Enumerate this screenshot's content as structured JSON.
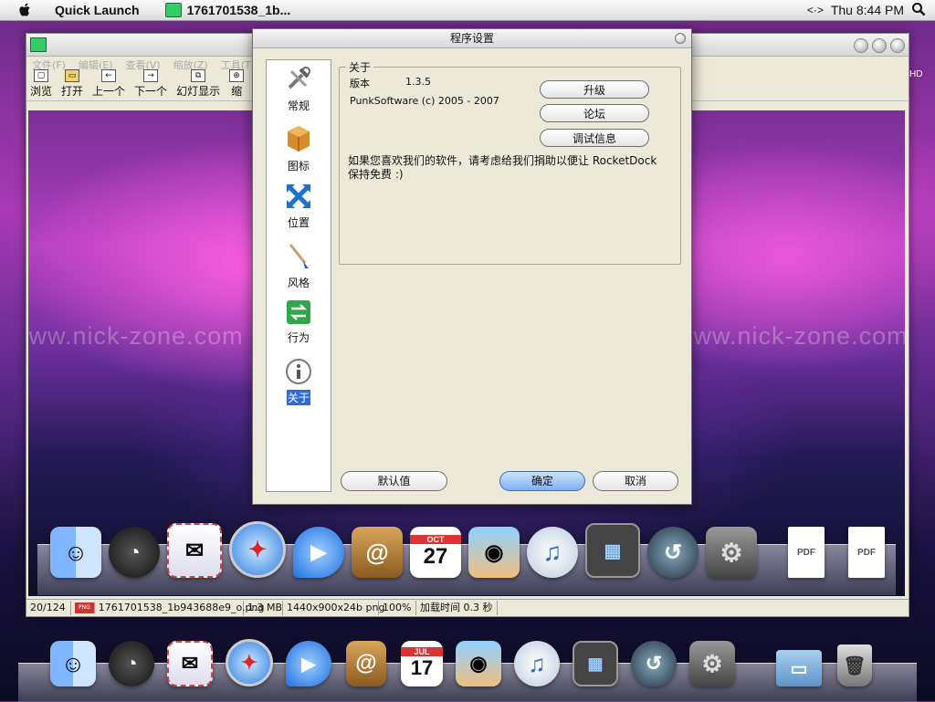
{
  "menubar": {
    "app_menu": "Quick Launch",
    "active_app": "1761701538_1b...",
    "clock": "Thu 8:44 PM"
  },
  "viewer": {
    "menu": [
      "文件(F)",
      "编辑(E)",
      "查看(V)",
      "缩放(Z)",
      "工具(T)"
    ],
    "toolbar": [
      "浏览",
      "打开",
      "上一个",
      "下一个",
      "幻灯显示",
      "缩"
    ],
    "watermark": "www.nick-zone.com",
    "status": {
      "position": "20/124",
      "filename": "1761701538_1b943688e9_o.png",
      "size": "1.3 MB",
      "dimensions": "1440x900x24b png",
      "zoom": "100%",
      "load_time": "加载时间 0.3 秒"
    },
    "hd_label": "HD"
  },
  "dialog": {
    "title": "程序设置",
    "sidebar": [
      {
        "label": "常规",
        "icon": "tools-icon"
      },
      {
        "label": "图标",
        "icon": "box-icon"
      },
      {
        "label": "位置",
        "icon": "arrows-icon"
      },
      {
        "label": "风格",
        "icon": "brush-icon"
      },
      {
        "label": "行为",
        "icon": "swap-arrows-icon"
      },
      {
        "label": "关于",
        "icon": "info-icon",
        "selected": true
      }
    ],
    "about": {
      "group_label": "关于",
      "version_label": "版本",
      "version_value": "1.3.5",
      "copyright": "PunkSoftware (c) 2005 - 2007",
      "donate_text": "如果您喜欢我们的软件，请考虑给我们捐助以便让 RocketDock 保持免费 :)",
      "upgrade_button": "升级",
      "forum_button": "论坛",
      "debug_button": "调试信息"
    },
    "buttons": {
      "defaults": "默认值",
      "ok": "确定",
      "cancel": "取消"
    }
  },
  "docks": {
    "upper": [
      "finder-icon",
      "dashboard-icon",
      "mail-icon",
      "safari-icon",
      "ichat-icon",
      "address-book-icon",
      "ical-icon",
      "iphoto-icon",
      "itunes-icon",
      "spaces-icon",
      "time-machine-icon",
      "system-preferences-icon",
      "pdf-icon",
      "pdf-icon"
    ],
    "lower": [
      "finder-icon",
      "dashboard-icon",
      "mail-icon",
      "safari-icon",
      "ichat-icon",
      "address-book-icon",
      "ical-icon",
      "iphoto-icon",
      "itunes-icon",
      "spaces-icon",
      "time-machine-icon",
      "system-preferences-icon",
      "folder-icon",
      "trash-icon"
    ],
    "upper_ical": {
      "month": "OCT",
      "day": "27"
    },
    "lower_ical": {
      "month": "JUL",
      "day": "17"
    }
  }
}
